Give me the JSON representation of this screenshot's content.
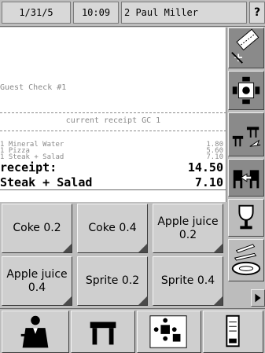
{
  "header": {
    "date": "1/31/5",
    "time": "10:09",
    "user": "2  Paul Miller",
    "help": "?"
  },
  "receipt": {
    "guest_check": "Guest Check #1",
    "current": "current receipt GC 1",
    "lines": [
      {
        "qty_name": "1 Mineral Water",
        "price": "1.80"
      },
      {
        "qty_name": "1 Pizza",
        "price": "5.60"
      },
      {
        "qty_name": "1 Steak + Salad",
        "price": "7.10"
      }
    ],
    "total_label": "receipt:",
    "total_value": "14.50",
    "selected_name": "Steak + Salad",
    "selected_price": "7.10"
  },
  "products": [
    {
      "label": "Coke 0.2"
    },
    {
      "label": "Coke 0.4"
    },
    {
      "label": "Apple juice 0.2"
    },
    {
      "label": "Apple juice 0.4"
    },
    {
      "label": "Sprite 0.2"
    },
    {
      "label": "Sprite 0.4"
    }
  ],
  "tools": [
    "discount-icon",
    "split-check-icon",
    "move-table-icon",
    "transfer-icon",
    "trophy-icon",
    "plate-icon"
  ],
  "bottom": [
    "waiter-icon",
    "table-icon",
    "table-plan-icon",
    "receipt-printer-icon"
  ],
  "colors": {
    "panel": "#bdbdbd",
    "button": "#cfcfcf",
    "tool_dark": "#8a8a8a",
    "receipt_bg": "#ffffff"
  }
}
